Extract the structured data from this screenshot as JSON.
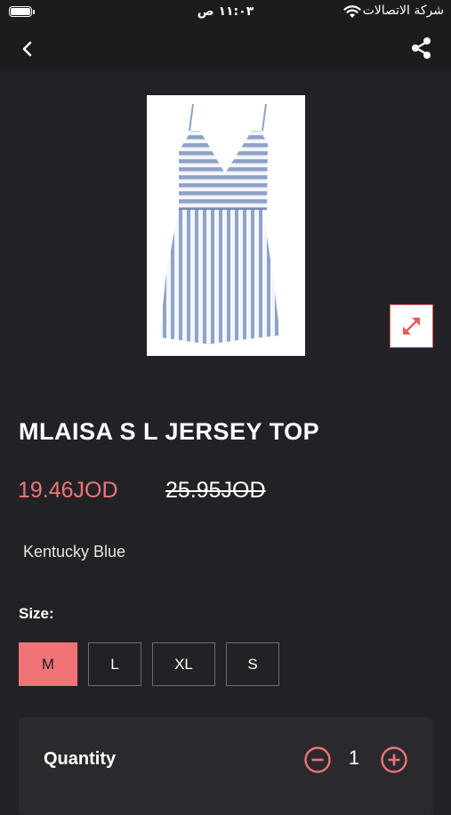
{
  "status_bar": {
    "time": "١١:٠٣ ص",
    "carrier": "شركة الاتصالات"
  },
  "nav": {
    "back_icon": "chevron-left-icon",
    "share_icon": "share-icon"
  },
  "product": {
    "title": "MLAISA S L JERSEY TOP",
    "sale_price": "19.46JOD",
    "original_price": "25.95JOD",
    "color_name": "Kentucky Blue",
    "image_icon": "striped-dress-image"
  },
  "size": {
    "label": "Size:",
    "selected": "M",
    "options": [
      "M",
      "L",
      "XL",
      "S"
    ]
  },
  "quantity": {
    "label": "Quantity",
    "value": "1"
  },
  "colors": {
    "accent": "#f07476",
    "background": "#222226",
    "bar": "#1c1c1f"
  }
}
